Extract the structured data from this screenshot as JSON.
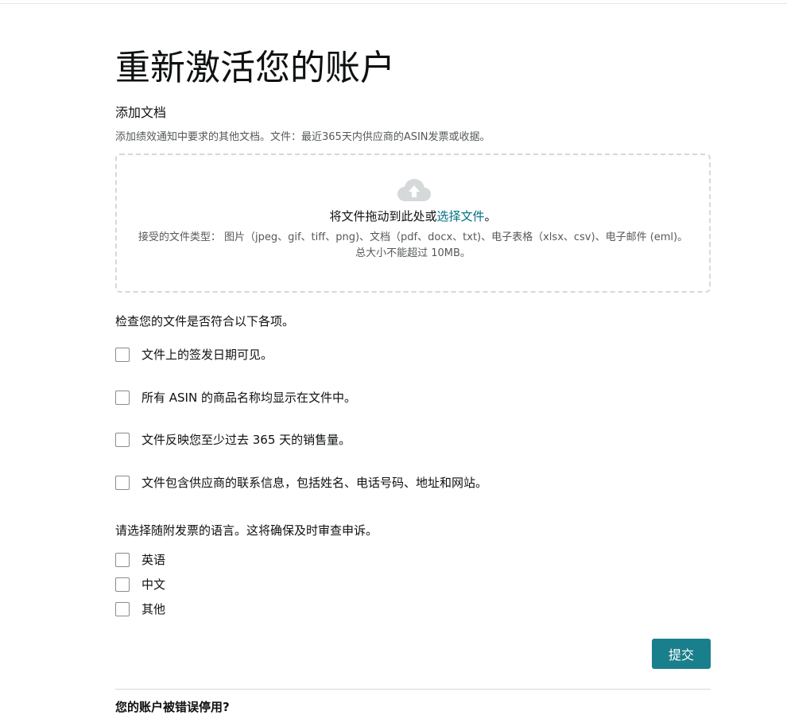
{
  "page": {
    "title": "重新激活您的账户"
  },
  "add_documents": {
    "heading": "添加文档",
    "description": "添加绩效通知中要求的其他文档。文件：最近365天内供应商的ASIN发票或收据。"
  },
  "dropzone": {
    "icon": "cloud-upload-icon",
    "main_text": "将文件拖动到此处或",
    "link_text": "选择文件",
    "main_suffix": "。",
    "accepted_types": "接受的文件类型： 图片（jpeg、gif、tiff、png)、文档（pdf、docx、txt)、电子表格（xlsx、csv)、电子邮件 (eml)。 总大小不能超过 10MB。"
  },
  "checklist": {
    "heading": "检查您的文件是否符合以下各项。",
    "items": [
      {
        "label": "文件上的签发日期可见。",
        "checked": false
      },
      {
        "label": "所有 ASIN 的商品名称均显示在文件中。",
        "checked": false
      },
      {
        "label": "文件反映您至少过去 365 天的销售量。",
        "checked": false
      },
      {
        "label": "文件包含供应商的联系信息，包括姓名、电话号码、地址和网站。",
        "checked": false
      }
    ]
  },
  "language": {
    "heading": "请选择随附发票的语言。这将确保及时审查申诉。",
    "options": [
      {
        "label": "英语",
        "checked": false
      },
      {
        "label": "中文",
        "checked": false
      },
      {
        "label": "其他",
        "checked": false
      }
    ]
  },
  "actions": {
    "submit_label": "提交"
  },
  "footer": {
    "question": "您的账户被错误停用?"
  },
  "colors": {
    "accent": "#1a7f8c",
    "link": "#007185",
    "text": "#0f1111",
    "muted": "#565959",
    "border": "#d5d9d9"
  }
}
